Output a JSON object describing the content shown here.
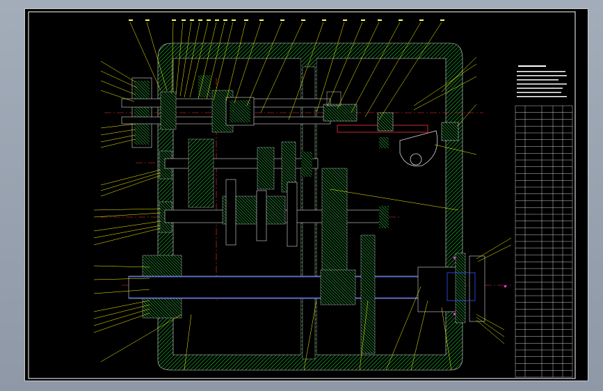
{
  "drawing": {
    "type": "gearbox assembly drawing (CAD, black background)",
    "colors": {
      "background": "#000000",
      "frame": "#ffffff",
      "housing_hatch": "#00cc33",
      "part_hatch": "#33dd33",
      "leader": "#ffff00",
      "center_line": "#ff3333",
      "shaft_blue": "#3355ff",
      "outline": "#ffffff",
      "bolt_magenta": "#ff33ff",
      "table_line": "#ffffff"
    }
  },
  "notes": {
    "lines": [
      "技术要求",
      "1.",
      "2.",
      "3.",
      "4.",
      "5."
    ]
  },
  "parts_table": {
    "rows": 40
  }
}
